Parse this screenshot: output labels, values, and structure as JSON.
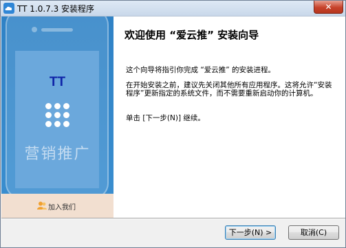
{
  "window": {
    "title": "TT 1.0.7.3 安装程序"
  },
  "banner": {
    "brand": "TT",
    "slogan": "营销推广",
    "join_label": "加入我们",
    "background_color": "#3a8bcc",
    "brand_color": "#0f24a8"
  },
  "content": {
    "heading": "欢迎使用 “爱云推” 安装向导",
    "paragraph1": "这个向导将指引你完成 “爱云推” 的安装进程。",
    "paragraph2": "在开始安装之前，建议先关闭其他所有应用程序。这将允许“安装程序”更新指定的系统文件，而不需要重新启动你的计算机。",
    "paragraph3": "单击 [下一步(N)] 继续。"
  },
  "buttons": {
    "next_label": "下一步(N) >",
    "cancel_label": "取消(C)"
  },
  "icons": {
    "app": "cloud-icon",
    "close": "close-icon",
    "grid": "grid-icon",
    "join": "users-icon"
  }
}
